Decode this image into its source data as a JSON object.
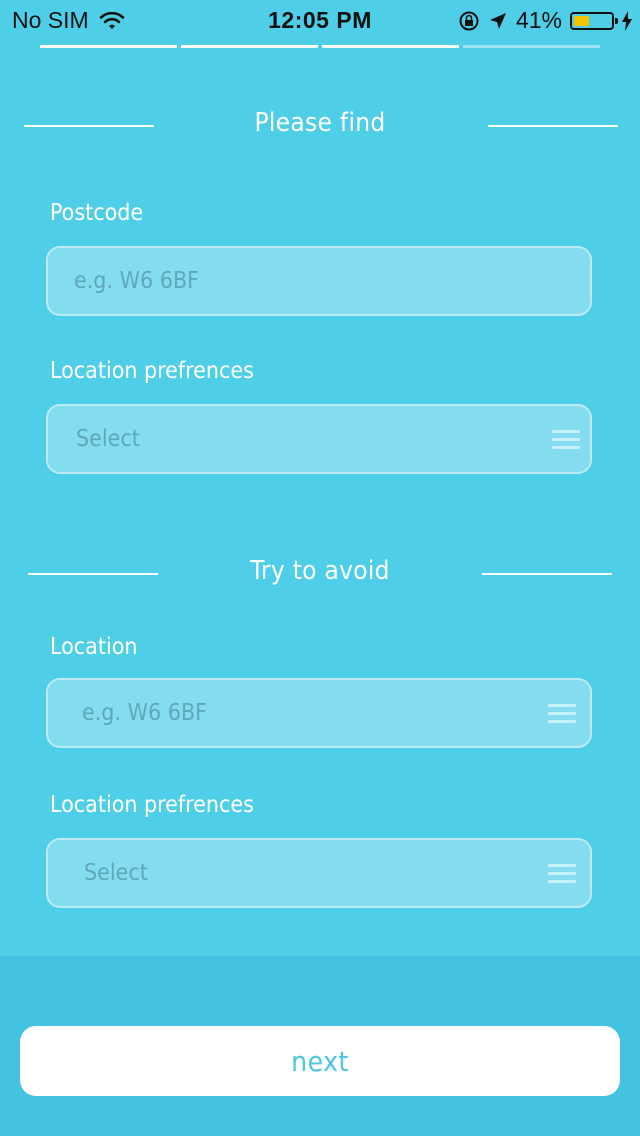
{
  "status_bar": {
    "carrier": "No SIM",
    "time": "12:05 PM",
    "battery_percent_text": "41%",
    "battery_level": 0.41,
    "icons": [
      "wifi-icon",
      "orientation-lock-icon",
      "location-arrow-icon",
      "battery-icon",
      "charging-bolt-icon"
    ]
  },
  "progress": {
    "total_steps": 4,
    "completed_steps": 3
  },
  "sections": {
    "find_title": "Please find",
    "avoid_title": "Try to avoid"
  },
  "find": {
    "postcode_label": "Postcode",
    "postcode_placeholder": "e.g. W6 6BF",
    "location_pref_label": "Location prefrences",
    "location_pref_value": "Select"
  },
  "avoid": {
    "location_label": "Location",
    "location_placeholder": "e.g. W6 6BF",
    "location_pref_label": "Location prefrences",
    "location_pref_value": "Select"
  },
  "footer": {
    "next_label": "next"
  },
  "colors": {
    "background": "#4fcee8",
    "footer_background": "#43c3e1",
    "text_light": "#ffffff",
    "placeholder": "#5fa7bb",
    "button_text": "#4ec6e2",
    "battery_fill": "#f3c400"
  }
}
